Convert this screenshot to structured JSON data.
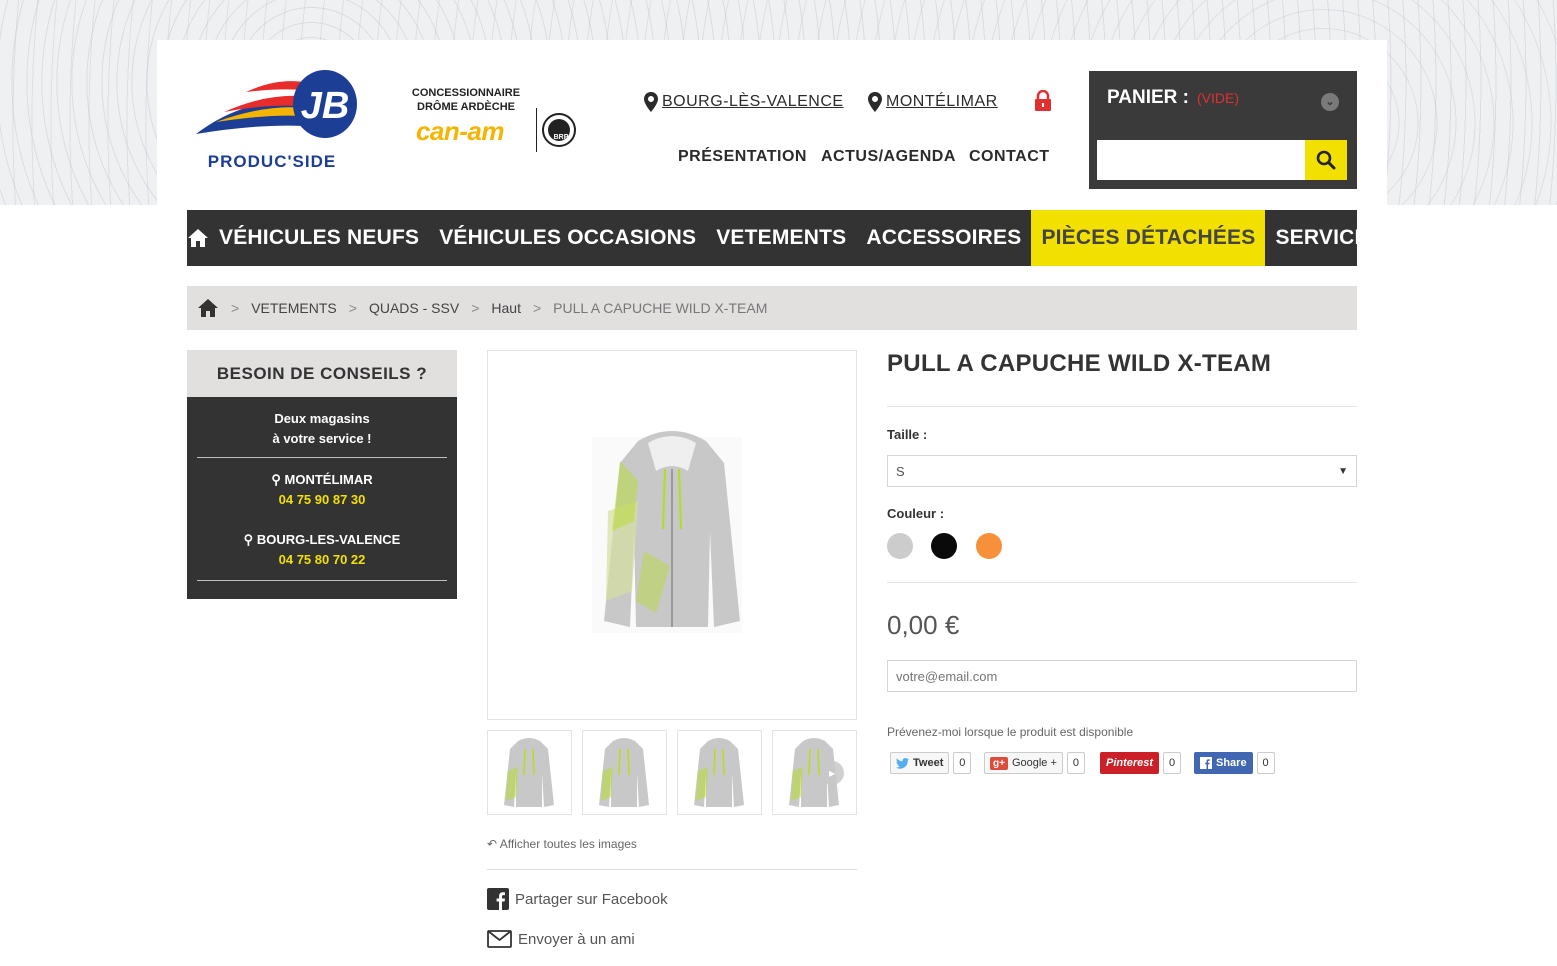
{
  "colors": {
    "accent_yellow": "#f2e000",
    "dark": "#333333",
    "cart_empty_red": "#e03030",
    "phone_yellow": "#f2e000"
  },
  "header": {
    "logo_text": "PRODUC'SIDE",
    "logo_mark": "JB",
    "dealer_line1": "CONCESSIONNAIRE",
    "dealer_line2": "DRÔME ARDÈCHE",
    "canam": "can-am",
    "brp": "BRP",
    "store1": "BOURG-LÈS-VALENCE",
    "store2": "MONTÉLIMAR",
    "topnav": [
      "PRÉSENTATION",
      "ACTUS/AGENDA",
      "CONTACT"
    ]
  },
  "cart": {
    "title": "PANIER :",
    "status": "(VIDE)"
  },
  "search": {
    "value": ""
  },
  "nav": {
    "items": [
      "VÉHICULES NEUFS",
      "VÉHICULES OCCASIONS",
      "VETEMENTS",
      "ACCESSOIRES",
      "PIÈCES DÉTACHÉES",
      "SERVICES"
    ]
  },
  "breadcrumb": {
    "items": [
      "VETEMENTS",
      "QUADS - SSV",
      "Haut"
    ],
    "current": "PULL A CAPUCHE WILD X-TEAM",
    "sep": ">"
  },
  "sidebar": {
    "title": "BESOIN DE CONSEILS ?",
    "intro1": "Deux magasins",
    "intro2": "à votre service !",
    "stores": [
      {
        "name": "MONTÉLIMAR",
        "phone": "04 75 90 87 30"
      },
      {
        "name": "BOURG-LES-VALENCE",
        "phone": "04 75 80 70 22"
      }
    ]
  },
  "product": {
    "title": "PULL A CAPUCHE WILD X-TEAM",
    "size_label": "Taille :",
    "size_value": "S",
    "color_label": "Couleur :",
    "colors": [
      "#cccccc",
      "#0a0a0a",
      "#f7903a"
    ],
    "price": "0,00 €",
    "email_placeholder": "votre@email.com",
    "notify_text": "Prévenez-moi lorsque le produit est disponible",
    "show_all": "Afficher toutes les images",
    "share_facebook": "Partager sur Facebook",
    "send_friend": "Envoyer à un ami"
  },
  "social": {
    "tweet": "Tweet",
    "tweet_count": "0",
    "google": "Google +",
    "google_count": "0",
    "pinterest": "Pinterest",
    "pinterest_count": "0",
    "share": "Share",
    "share_count": "0"
  }
}
